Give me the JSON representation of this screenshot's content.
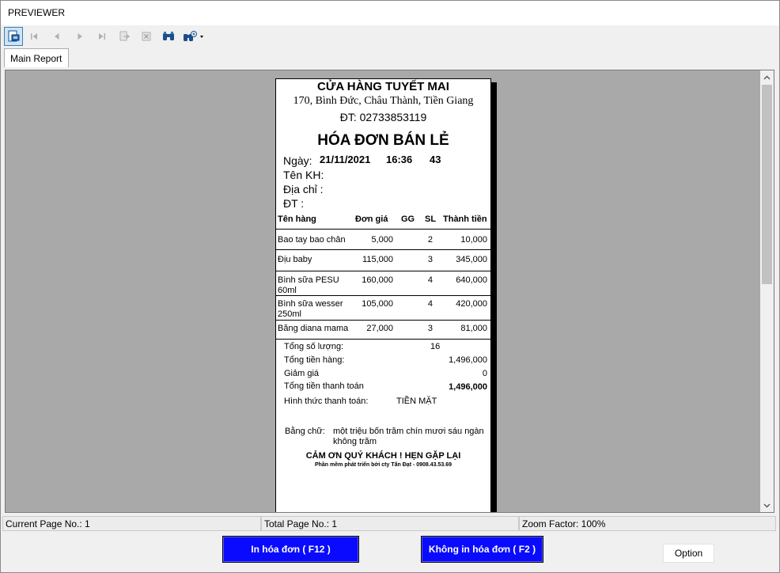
{
  "window": {
    "title": "PREVIEWER"
  },
  "toolbar": {
    "buttons": [
      "print-preview-icon",
      "first-page-icon",
      "previous-page-icon",
      "next-page-icon",
      "last-page-icon",
      "export-icon",
      "close-doc-icon",
      "binoculars-icon",
      "zoom-icon"
    ]
  },
  "tabs": [
    {
      "label": "Main Report"
    }
  ],
  "receipt": {
    "store_name": "CỬA HÀNG TUYẾT MAI",
    "address": "170, Bình Đức, Châu Thành, Tiền Giang",
    "phone_line": "ĐT: 02733853119",
    "heading": "HÓA ĐƠN BÁN LẺ",
    "date_label": "Ngày:",
    "date_value": "21/11/2021",
    "time_value": "16:36",
    "invoice_no": "43",
    "customer_label": "Tên KH:",
    "address_label": "Địa chỉ :",
    "phone_label": "ĐT :",
    "columns": {
      "item": "Tên hàng",
      "price": "Đơn giá",
      "discount": "GG",
      "qty": "SL",
      "amount": "Thành tiền"
    },
    "items": [
      {
        "name": "Bao tay bao chân",
        "name2": "",
        "price": "5,000",
        "qty": "2",
        "amount": "10,000"
      },
      {
        "name": "Địu baby",
        "name2": "",
        "price": "115,000",
        "qty": "3",
        "amount": "345,000"
      },
      {
        "name": "Bình sữa PESU",
        "name2": "60ml",
        "price": "160,000",
        "qty": "4",
        "amount": "640,000"
      },
      {
        "name": "Bình sữa wesser",
        "name2": "250ml",
        "price": "105,000",
        "qty": "4",
        "amount": "420,000"
      },
      {
        "name": "Băng diana mama",
        "name2": "",
        "price": "27,000",
        "qty": "3",
        "amount": "81,000"
      }
    ],
    "total_qty_label": "Tổng số lượng:",
    "total_qty": "16",
    "subtotal_label": "Tổng tiền hàng:",
    "subtotal": "1,496,000",
    "discount_label": "Giảm giá",
    "discount": "0",
    "total_label": "Tổng tiền thanh toán",
    "total": "1,496,000",
    "payment_label": "Hình thức thanh toán:",
    "payment": "TIỀN MẶT",
    "in_words_label": "Bằng chữ:",
    "in_words_line1": "một triệu bốn trăm chín mươi sáu ngàn",
    "in_words_line2": "không trăm",
    "thanks": "CẢM ƠN QUÝ KHÁCH ! HẸN GẶP LẠI",
    "credit": "Phần mềm phát triển bởi cty Tấn Đạt - 0908.43.53.69"
  },
  "status": {
    "current_page": "Current Page No.: 1",
    "total_page": "Total Page No.: 1",
    "zoom": "Zoom Factor: 100%"
  },
  "actions": {
    "print": "In hóa đơn ( F12 )",
    "no_print": "Không in hóa đơn ( F2 )",
    "option": "Option"
  },
  "colors": {
    "action_blue": "#0a0aff",
    "viewer_gray": "#a9a9a9"
  }
}
